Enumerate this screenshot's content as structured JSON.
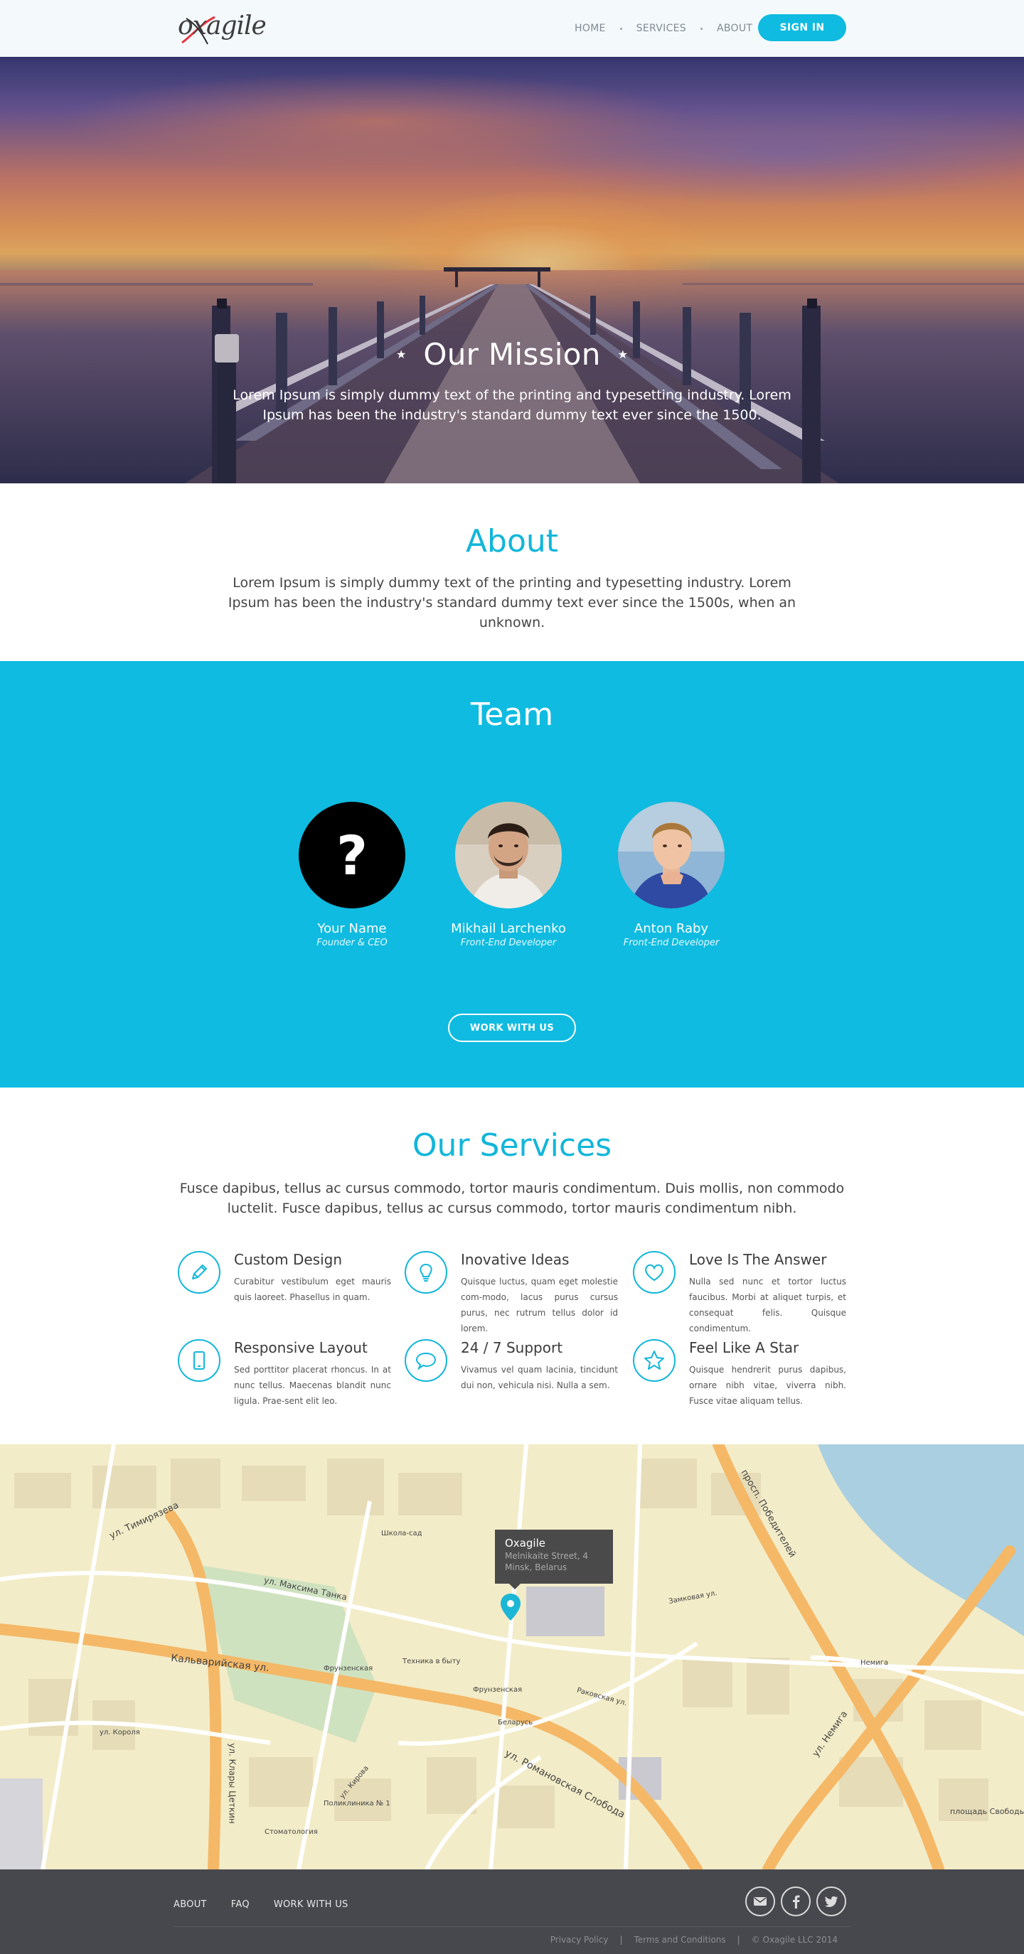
{
  "header": {
    "logo_text": "oxagile",
    "nav": [
      "HOME",
      "SERVICES",
      "ABOUT"
    ],
    "sign_in": "SIGN IN"
  },
  "hero": {
    "title": "Our Mission",
    "star": "★",
    "text": "Lorem Ipsum is simply dummy text of the printing and typesetting industry. Lorem Ipsum has been the industry's standard dummy text ever since the 1500."
  },
  "about": {
    "title": "About",
    "text": "Lorem Ipsum is simply dummy text of the printing and typesetting industry. Lorem Ipsum has been the industry's standard dummy text ever since the 1500s, when an unknown."
  },
  "team": {
    "title": "Team",
    "members": [
      {
        "name": "Your Name",
        "role": "Founder & CEO",
        "avatar": "?"
      },
      {
        "name": "Mikhail Larchenko",
        "role": "Front-End Developer"
      },
      {
        "name": "Anton Raby",
        "role": "Front-End Developer"
      }
    ],
    "button": "WORK WITH US"
  },
  "services": {
    "title": "Our Services",
    "text": "Fusce dapibus, tellus ac cursus commodo, tortor mauris condimentum. Duis mollis, non commodo luctelit. Fusce dapibus, tellus ac cursus commodo, tortor mauris condimentum nibh.",
    "items": [
      {
        "title": "Custom Design",
        "icon": "pencil-icon",
        "text": "Curabitur vestibulum eget mauris quis laoreet. Phasellus in quam."
      },
      {
        "title": "Inovative Ideas",
        "icon": "lightbulb-icon",
        "text": "Quisque luctus, quam eget molestie com-modo, lacus purus cursus purus, nec rutrum tellus dolor id lorem."
      },
      {
        "title": "Love Is The Answer",
        "icon": "heart-icon",
        "text": "Nulla sed nunc et tortor luctus faucibus. Morbi at aliquet turpis, et consequat felis. Quisque condimentum."
      },
      {
        "title": "Responsive Layout",
        "icon": "tablet-icon",
        "text": "Sed porttitor placerat rhoncus. In at nunc tellus. Maecenas blandit nunc ligula. Prae-sent elit leo."
      },
      {
        "title": "24 / 7 Support",
        "icon": "chat-bubble-icon",
        "text": "Vivamus vel quam lacinia, tincidunt dui non, vehicula nisi. Nulla a sem."
      },
      {
        "title": "Feel Like A Star",
        "icon": "star-icon",
        "text": "Quisque hendrerit purus dapibus, ornare nibh vitae, viverra nibh. Fusce vitae aliquam tellus."
      }
    ]
  },
  "map": {
    "popup_title": "Oxagile",
    "popup_address": "Melnikaite Street, 4",
    "popup_city": "Minsk, Belarus",
    "labels": [
      "ул. Тимирязева",
      "ул. Максима Танка",
      "Кальварийская ул.",
      "ул. Романовская Слобода",
      "просп. Победителей",
      "ул. Немига",
      "Раковская ул.",
      "Замковая ул.",
      "ул. Короля",
      "ул. Кирова",
      "Фрунзенская",
      "Немига",
      "Беларусь",
      "площадь Свободы",
      "ул. Клары Цеткин",
      "Школа-сад",
      "Техника в быту",
      "Стоматология",
      "Поликлиника № 1"
    ]
  },
  "footer": {
    "links": [
      "ABOUT",
      "FAQ",
      "WORK WITH US"
    ],
    "privacy": "Privacy Policy",
    "terms": "Terms and Conditions",
    "copyright": "© Oxagile LLC 2014",
    "separator": "|"
  },
  "colors": {
    "accent": "#0fbbe0",
    "footer": "#47484d"
  }
}
